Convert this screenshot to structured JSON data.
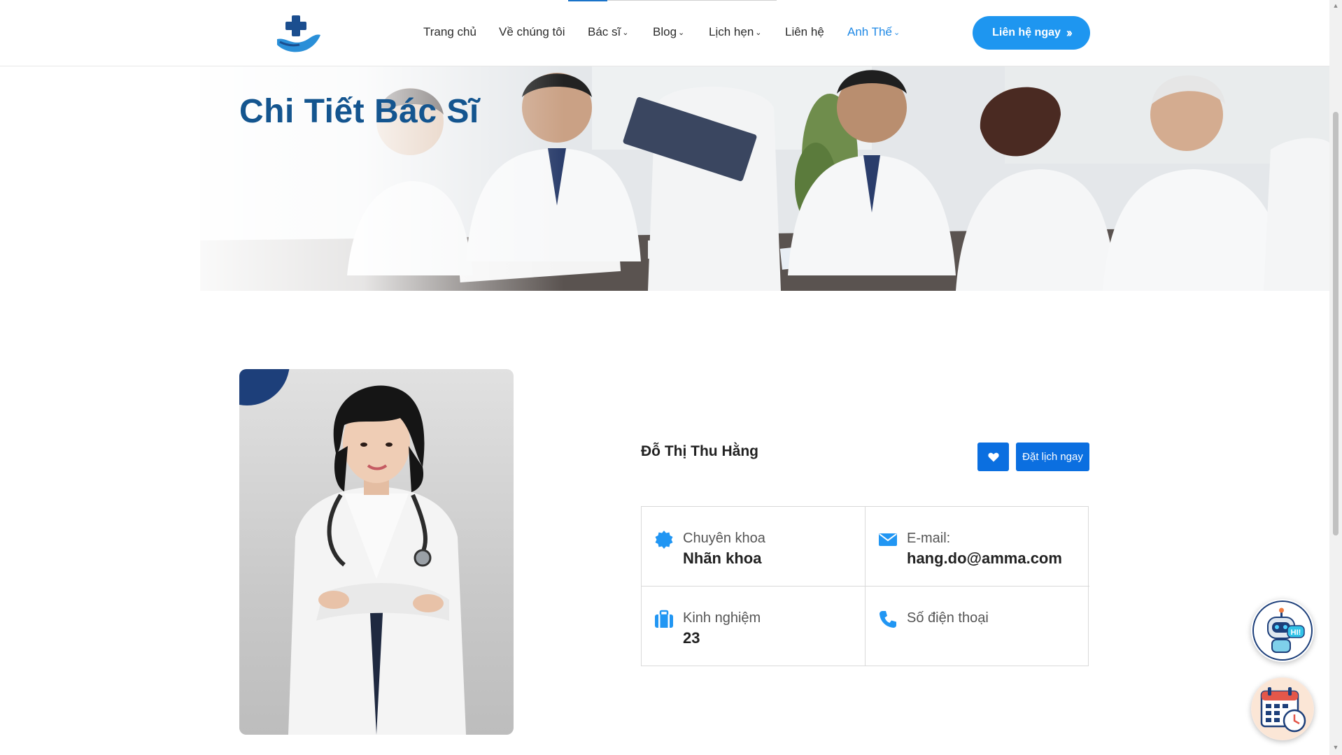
{
  "header": {
    "nav": [
      {
        "label": "Trang chủ",
        "dropdown": false,
        "active": false
      },
      {
        "label": "Về chúng tôi",
        "dropdown": false,
        "active": false
      },
      {
        "label": "Bác sĩ",
        "dropdown": true,
        "active": false
      },
      {
        "label": "Blog",
        "dropdown": true,
        "active": false
      },
      {
        "label": "Lịch hẹn",
        "dropdown": true,
        "active": false
      },
      {
        "label": "Liên hệ",
        "dropdown": false,
        "active": false
      },
      {
        "label": "Anh Thế",
        "dropdown": true,
        "active": true
      }
    ],
    "cta_label": "Liên hệ ngay"
  },
  "banner": {
    "title": "Chi Tiết Bác Sĩ"
  },
  "doctor": {
    "name": "Đỗ Thị Thu Hằng",
    "book_label": "Đặt lịch ngay",
    "specialty_label": "Chuyên khoa",
    "specialty_value": "Nhãn khoa",
    "email_label": "E-mail:",
    "email_value": "hang.do@amma.com",
    "experience_label": "Kinh nghiệm",
    "experience_value": "23",
    "phone_label": "Số điện thoại",
    "phone_value": ""
  },
  "widgets": {
    "bot_badge": "HI!"
  },
  "colors": {
    "brand_blue": "#1e96f0",
    "title_blue": "#14558f",
    "button_blue": "#0b6fe0",
    "icon_blue": "#2196f3",
    "active_nav": "#1e88e5"
  }
}
